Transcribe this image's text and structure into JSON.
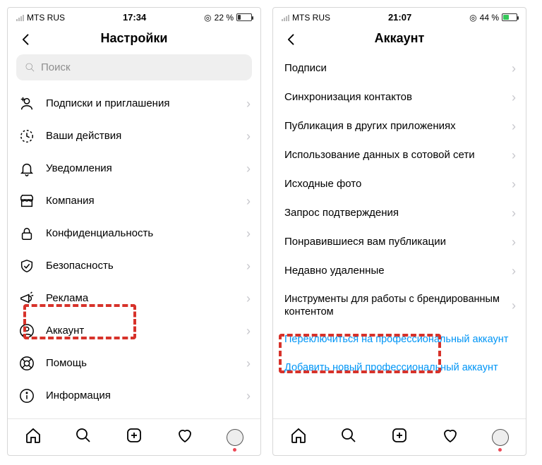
{
  "left": {
    "status": {
      "carrier": "MTS RUS",
      "time": "17:34",
      "battery_text": "22 %"
    },
    "header": {
      "title": "Настройки"
    },
    "search": {
      "placeholder": "Поиск"
    },
    "items": [
      {
        "label": "Подписки и приглашения"
      },
      {
        "label": "Ваши действия"
      },
      {
        "label": "Уведомления"
      },
      {
        "label": "Компания"
      },
      {
        "label": "Конфиденциальность"
      },
      {
        "label": "Безопасность"
      },
      {
        "label": "Реклама"
      },
      {
        "label": "Аккаунт"
      },
      {
        "label": "Помощь"
      },
      {
        "label": "Информация"
      }
    ]
  },
  "right": {
    "status": {
      "carrier": "MTS RUS",
      "time": "21:07",
      "battery_text": "44 %"
    },
    "header": {
      "title": "Аккаунт"
    },
    "items": [
      {
        "label": "Подписи"
      },
      {
        "label": "Синхронизация контактов"
      },
      {
        "label": "Публикация в других приложениях"
      },
      {
        "label": "Использование данных в сотовой сети"
      },
      {
        "label": "Исходные фото"
      },
      {
        "label": "Запрос подтверждения"
      },
      {
        "label": "Понравившиеся вам публикации"
      },
      {
        "label": "Недавно удаленные"
      },
      {
        "label": "Инструменты для работы с брендированным контентом"
      }
    ],
    "links": [
      "Переключиться на профессиональный аккаунт",
      "Добавить новый профессиональный аккаунт"
    ]
  },
  "ring_icon": "◎"
}
